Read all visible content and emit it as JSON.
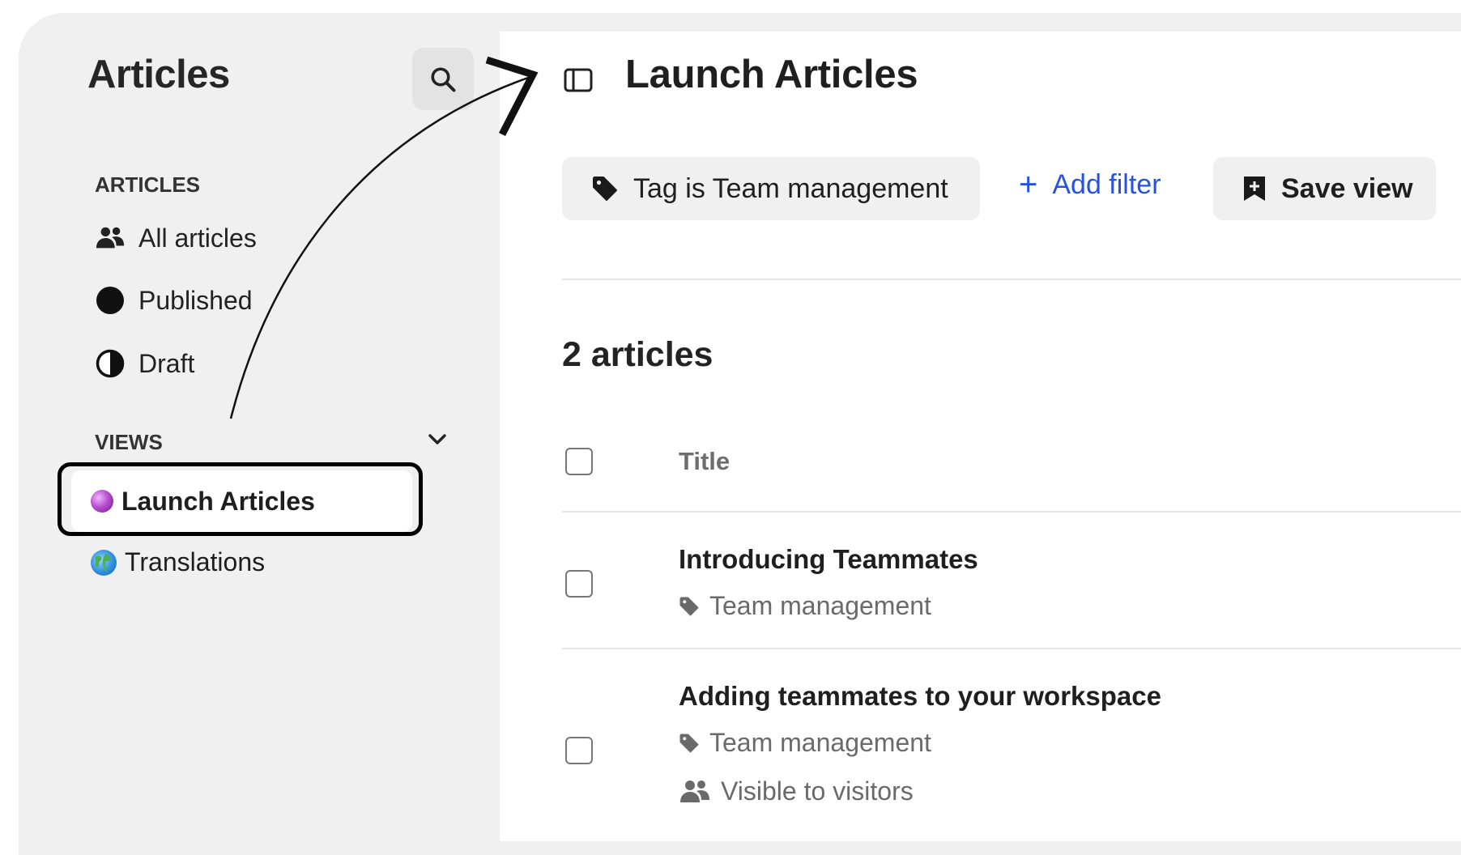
{
  "sidebar": {
    "title": "Articles",
    "articles_section": "ARTICLES",
    "items": [
      {
        "label": "All articles",
        "icon": "people-icon"
      },
      {
        "label": "Published",
        "icon": "filled-circle-icon"
      },
      {
        "label": "Draft",
        "icon": "half-circle-icon"
      }
    ],
    "views_section": "VIEWS",
    "views": [
      {
        "label": "Launch Articles",
        "icon": "crystal-ball-icon",
        "active": true
      },
      {
        "label": "Translations",
        "icon": "globe-icon",
        "active": false
      }
    ]
  },
  "header": {
    "title": "Launch Articles"
  },
  "filters": {
    "tag_filter": "Tag is Team management",
    "add_filter": "Add filter",
    "save_view": "Save view"
  },
  "list": {
    "count": "2 articles",
    "column_title": "Title",
    "rows": [
      {
        "title": "Introducing Teammates",
        "tag": "Team management"
      },
      {
        "title": "Adding teammates to your workspace",
        "tag": "Team management",
        "visibility": "Visible to visitors"
      }
    ]
  },
  "colors": {
    "accent": "#2552e0",
    "sidebar_bg": "#f0f0f0",
    "callout_border": "#000000"
  }
}
